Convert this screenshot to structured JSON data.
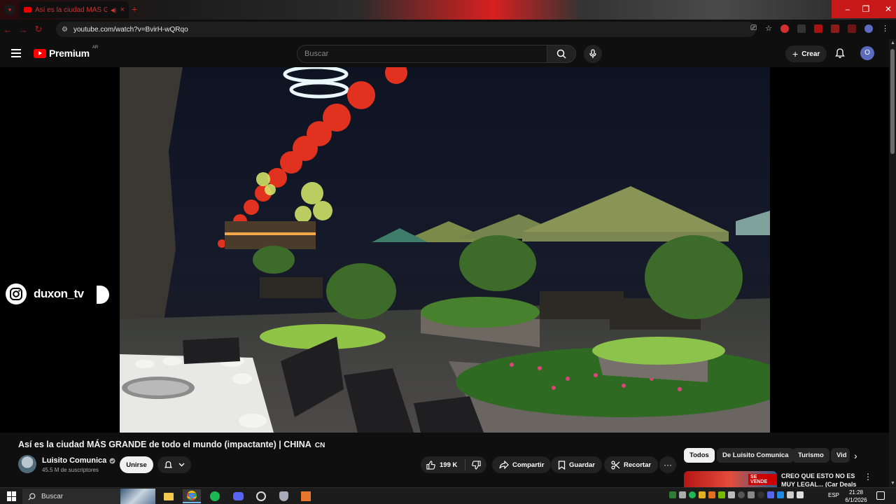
{
  "browser": {
    "tab_title": "Así es la ciudad MÁS GRA...",
    "tab_close": "×",
    "new_tab": "+",
    "url": "youtube.com/watch?v=BvirH-wQRqo"
  },
  "header": {
    "logo_text": "Premium",
    "region_badge": "AR",
    "search_placeholder": "Buscar",
    "create_label": "Crear",
    "avatar_letter": "O"
  },
  "overlay": {
    "instagram_handle": "duxon_tv"
  },
  "video": {
    "title": "Así es la ciudad MÁS GRANDE de todo el mundo (impactante) | CHINA",
    "flag_code": "CN",
    "channel_name": "Luisito Comunica",
    "subscribers": "45.5 M de suscriptores",
    "join_label": "Unirse",
    "likes": "199 K",
    "share_label": "Compartir",
    "save_label": "Guardar",
    "clip_label": "Recortar",
    "more_label": "···"
  },
  "chips": [
    "Todos",
    "De Luisito Comunica",
    "Turismo",
    "Vid"
  ],
  "recommendation": {
    "title": "CREO QUE ESTO NO ES MUY LEGAL... (Car Deals",
    "thumb_badge": "SE VENDE"
  },
  "taskbar": {
    "search_placeholder": "Buscar",
    "language": "ESP",
    "time": "21:28",
    "date": "6/1/2026"
  },
  "colors": {
    "youtube_red": "#ff0000",
    "accent_avatar": "#5c6bc0",
    "browser_accent": "#c81818"
  }
}
